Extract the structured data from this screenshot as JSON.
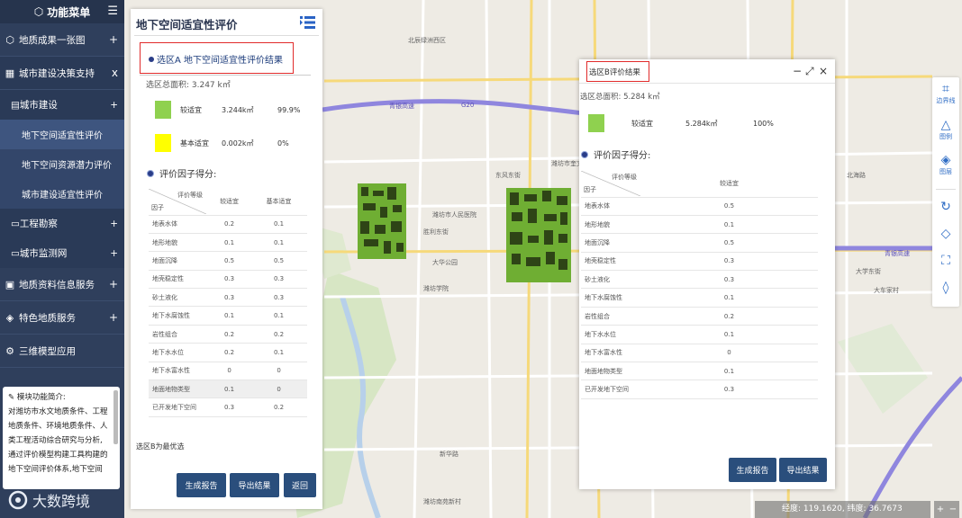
{
  "sidebar": {
    "title": "功能菜单",
    "items": [
      {
        "label": "地质成果一张图",
        "icon": "cube-icon"
      },
      {
        "label": "城市建设决策支持",
        "icon": "building-icon"
      },
      {
        "label": "地质资料信息服务",
        "icon": "document-icon"
      },
      {
        "label": "特色地质服务",
        "icon": "pin-icon"
      },
      {
        "label": "三维模型应用",
        "icon": "gear-icon"
      }
    ],
    "close_label": "x",
    "sub": {
      "city_build": "城市建设",
      "children": [
        "地下空间适宜性评价",
        "地下空间资源潜力评价",
        "城市建设适宜性评价"
      ],
      "engineering": "工程勘察",
      "monitoring": "城市监测网"
    },
    "plus": "+",
    "intro_title": "模块功能简介:",
    "intro_lines": [
      "对潍坊市水文地质条件、工程",
      "地质条件、环境地质条件、人",
      "类工程活动综合研究与分析,",
      "通过评价模型构建工具构建的",
      "地下空间评价体系,地下空间"
    ]
  },
  "logo": {
    "text": "大数跨境"
  },
  "panel_a": {
    "title": "地下空间适宜性评价",
    "result_title": "选区A 地下空间适宜性评价结果",
    "area": "选区总面积: 3.247 k㎡",
    "legend": [
      {
        "label": "较适宜",
        "value": "3.244k㎡",
        "percent": "99.9%",
        "color": "#8fd14f"
      },
      {
        "label": "基本适宜",
        "value": "0.002k㎡",
        "percent": "0%",
        "color": "#ffff00"
      }
    ],
    "factor_heading": "评价因子得分:",
    "table_header": {
      "top": "评价等级",
      "bottom": "因子",
      "cols": [
        "较适宜",
        "基本适宜"
      ]
    },
    "rows": [
      [
        "地表水体",
        "0.2",
        "0.1"
      ],
      [
        "地形地貌",
        "0.1",
        "0.1"
      ],
      [
        "地面沉降",
        "0.5",
        "0.5"
      ],
      [
        "地壳稳定性",
        "0.3",
        "0.3"
      ],
      [
        "砂土液化",
        "0.3",
        "0.3"
      ],
      [
        "地下水腐蚀性",
        "0.1",
        "0.1"
      ],
      [
        "岩性组合",
        "0.2",
        "0.2"
      ],
      [
        "地下水水位",
        "0.2",
        "0.1"
      ],
      [
        "地下水富水性",
        "0",
        "0"
      ],
      [
        "地面地物类型",
        "0.1",
        "0"
      ],
      [
        "已开发地下空间",
        "0.3",
        "0.2"
      ]
    ],
    "note": "选区B为最优选",
    "buttons": [
      "生成报告",
      "导出结果",
      "返回"
    ]
  },
  "panel_b": {
    "title": "选区B评价结果",
    "area": "选区总面积: 5.284 k㎡",
    "legend": [
      {
        "label": "较适宜",
        "value": "5.284k㎡",
        "percent": "100%",
        "color": "#8fd14f"
      }
    ],
    "factor_heading": "评价因子得分:",
    "table_header": {
      "top": "评价等级",
      "bottom": "因子",
      "col": "较适宜"
    },
    "rows": [
      [
        "地表水体",
        "0.5"
      ],
      [
        "地形地貌",
        "0.1"
      ],
      [
        "地面沉降",
        "0.5"
      ],
      [
        "地壳稳定性",
        "0.3"
      ],
      [
        "砂土液化",
        "0.3"
      ],
      [
        "地下水腐蚀性",
        "0.1"
      ],
      [
        "岩性组合",
        "0.2"
      ],
      [
        "地下水水位",
        "0.1"
      ],
      [
        "地下水富水性",
        "0"
      ],
      [
        "地面地物类型",
        "0.1"
      ],
      [
        "已开发地下空间",
        "0.3"
      ]
    ],
    "buttons": [
      "生成报告",
      "导出结果"
    ],
    "controls": [
      "−",
      "⤢",
      "×"
    ]
  },
  "toolbar": [
    {
      "label": "边界线",
      "icon": "crop-icon"
    },
    {
      "label": "图例",
      "icon": "legend-icon"
    },
    {
      "label": "图层",
      "icon": "layers-icon"
    },
    {
      "label": "",
      "icon": "refresh-icon"
    },
    {
      "label": "",
      "icon": "polygon-icon"
    },
    {
      "label": "",
      "icon": "fullscreen-icon"
    },
    {
      "label": "",
      "icon": "eraser-icon"
    }
  ],
  "coords": "经度: 119.1620, 纬度: 36.7673",
  "zoom": [
    "+",
    "−"
  ],
  "map_labels": {
    "highway": "青银高速",
    "road_id": "G20",
    "places": [
      "北辰绿洲西区",
      "潍坊市奎文区",
      "东风东街",
      "胜利东街",
      "潍坊市人民医院",
      "大华公园",
      "潍坊学院",
      "大学东街",
      "新华路",
      "大车家村",
      "北海路",
      "潍坊南苑新村"
    ]
  }
}
